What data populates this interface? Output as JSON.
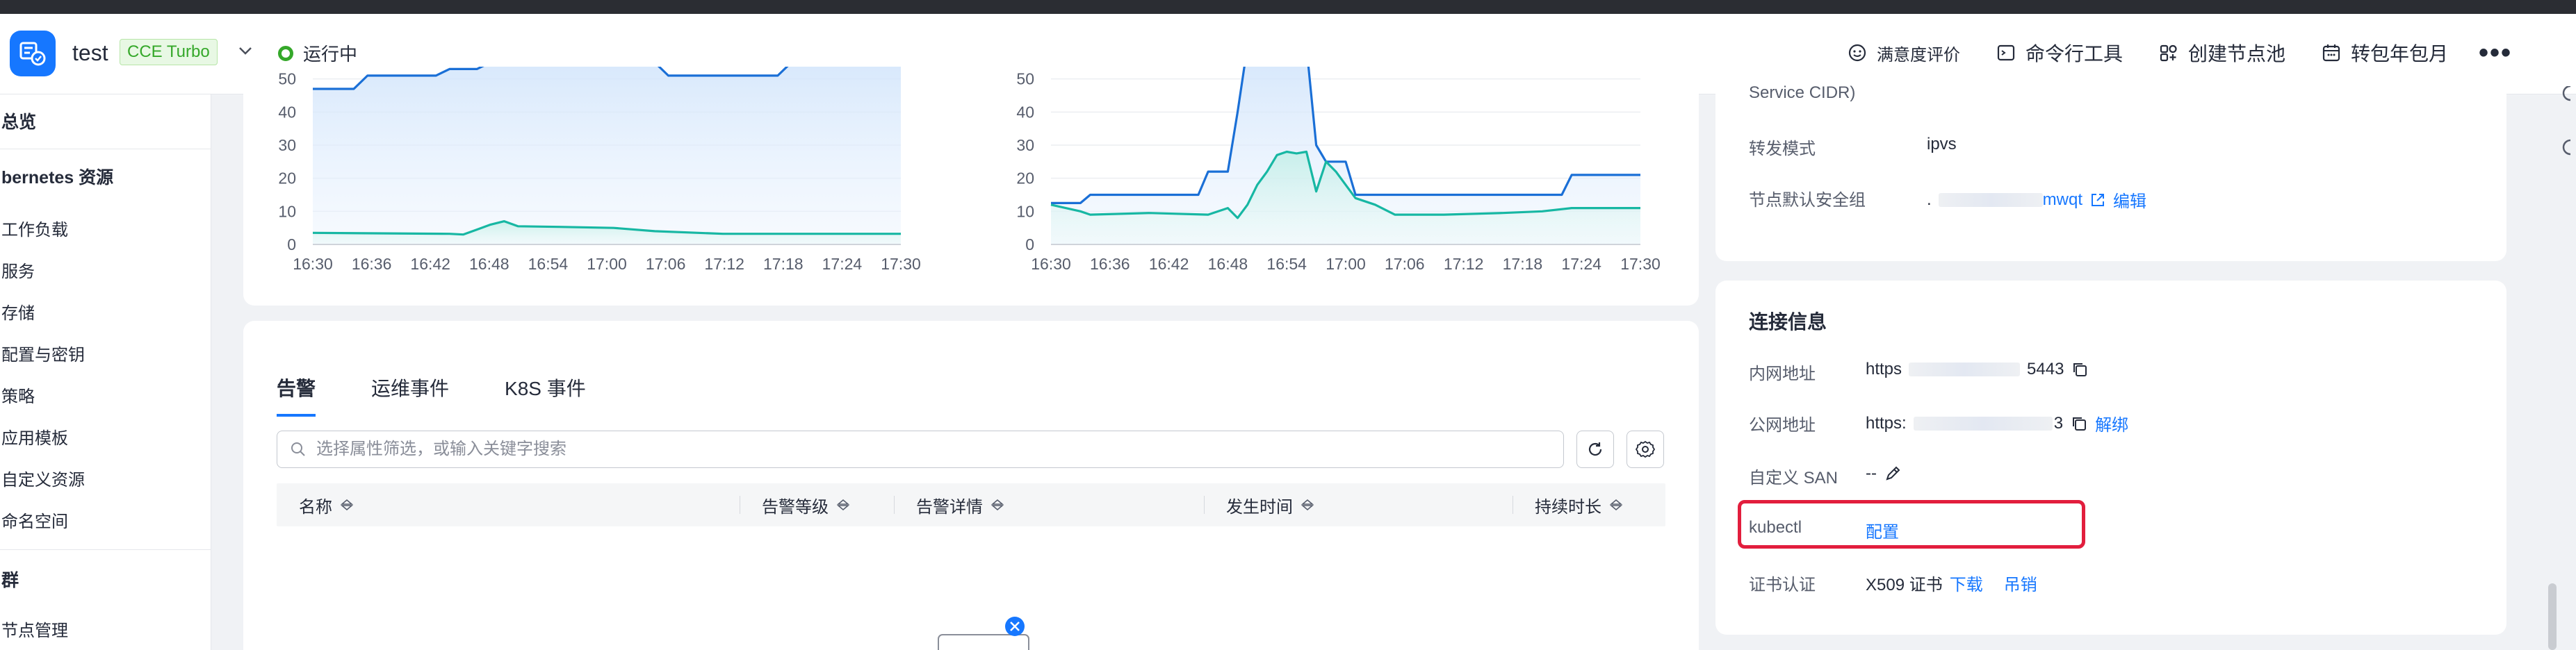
{
  "header": {
    "app_name": "test",
    "badge": "CCE Turbo",
    "status": "运行中",
    "actions": [
      {
        "label": "满意度评价",
        "icon": "smile-icon"
      },
      {
        "label": "命令行工具",
        "icon": "terminal-icon"
      },
      {
        "label": "创建节点池",
        "icon": "nodepool-icon"
      },
      {
        "label": "转包年包月",
        "icon": "calendar-icon"
      }
    ],
    "more": "•••"
  },
  "sidebar": {
    "items": [
      {
        "label": "总览",
        "bold": true
      },
      {
        "label": "bernetes 资源",
        "bold": true
      },
      {
        "label": "工作负载"
      },
      {
        "label": "服务"
      },
      {
        "label": "存储"
      },
      {
        "label": "配置与密钥"
      },
      {
        "label": "策略"
      },
      {
        "label": "应用模板"
      },
      {
        "label": "自定义资源"
      },
      {
        "label": "命名空间"
      },
      {
        "label": "群",
        "bold": true
      },
      {
        "label": "节点管理"
      }
    ]
  },
  "colors": {
    "accent": "#1677ff",
    "series_blue": "#1a6fd6",
    "series_teal": "#17b7a3",
    "status_green": "#35a82a",
    "highlight_red": "#e21e3d"
  },
  "chart_data": [
    {
      "type": "line",
      "title": "",
      "x": [
        "16:30",
        "16:36",
        "16:42",
        "16:48",
        "16:54",
        "17:00",
        "17:06",
        "17:12",
        "17:18",
        "17:24",
        "17:30"
      ],
      "ylim": [
        0,
        60
      ],
      "yticks": [
        0,
        10,
        20,
        30,
        40,
        50
      ],
      "series": [
        {
          "points": [
            [
              0,
              47
            ],
            [
              3,
              47
            ],
            [
              4,
              51
            ],
            [
              9,
              51
            ],
            [
              10,
              53
            ],
            [
              12,
              53
            ],
            [
              13,
              55
            ],
            [
              14,
              58
            ],
            [
              15,
              60
            ],
            [
              22,
              60
            ],
            [
              23,
              55
            ],
            [
              25,
              55
            ],
            [
              26,
              51
            ],
            [
              34,
              51
            ],
            [
              35,
              55
            ],
            [
              42,
              55
            ],
            [
              43,
              55
            ]
          ],
          "color": "#1a6fd6"
        },
        {
          "points": [
            [
              0,
              3.5
            ],
            [
              10,
              3.2
            ],
            [
              11,
              3
            ],
            [
              12,
              4.5
            ],
            [
              13,
              6
            ],
            [
              14,
              7
            ],
            [
              15,
              5.5
            ],
            [
              18,
              5.3
            ],
            [
              22,
              5
            ],
            [
              25,
              4
            ],
            [
              30,
              3.2
            ],
            [
              43,
              3.2
            ]
          ],
          "color": "#17b7a3"
        }
      ]
    },
    {
      "type": "line",
      "title": "",
      "x": [
        "16:30",
        "16:36",
        "16:42",
        "16:48",
        "16:54",
        "17:00",
        "17:06",
        "17:12",
        "17:18",
        "17:24",
        "17:30"
      ],
      "ylim": [
        0,
        60
      ],
      "yticks": [
        0,
        10,
        20,
        30,
        40,
        50
      ],
      "series": [
        {
          "points": [
            [
              0,
              12.5
            ],
            [
              3,
              12.5
            ],
            [
              4,
              15
            ],
            [
              15,
              15
            ],
            [
              16,
              22
            ],
            [
              18,
              22
            ],
            [
              19,
              40
            ],
            [
              20,
              60
            ],
            [
              26,
              60
            ],
            [
              27,
              30
            ],
            [
              28,
              25
            ],
            [
              30,
              25
            ],
            [
              31,
              15
            ],
            [
              41,
              15
            ],
            [
              42,
              15
            ],
            [
              52,
              15
            ],
            [
              53,
              21
            ],
            [
              60,
              21
            ]
          ],
          "color": "#1a6fd6"
        },
        {
          "points": [
            [
              0,
              12
            ],
            [
              3,
              10
            ],
            [
              4,
              9
            ],
            [
              10,
              9.5
            ],
            [
              16,
              9
            ],
            [
              18,
              11
            ],
            [
              19,
              8
            ],
            [
              20,
              12
            ],
            [
              21,
              18
            ],
            [
              22,
              22
            ],
            [
              23,
              27
            ],
            [
              24,
              28
            ],
            [
              25,
              27.5
            ],
            [
              26,
              28
            ],
            [
              27,
              16
            ],
            [
              28,
              25
            ],
            [
              29,
              22
            ],
            [
              31,
              14
            ],
            [
              33,
              12
            ],
            [
              35,
              9
            ],
            [
              40,
              9
            ],
            [
              46,
              9.5
            ],
            [
              50,
              10
            ],
            [
              53,
              11
            ],
            [
              60,
              11
            ]
          ],
          "color": "#17b7a3"
        }
      ]
    }
  ],
  "alerts": {
    "tabs": [
      "告警",
      "运维事件",
      "K8S 事件"
    ],
    "search_placeholder": "选择属性筛选，或输入关键字搜索",
    "columns": [
      "名称",
      "告警等级",
      "告警详情",
      "发生时间",
      "持续时长"
    ]
  },
  "network": {
    "partial_label": "Service CIDR)",
    "rows": [
      {
        "label": "转发模式",
        "value": "ipvs"
      },
      {
        "label": "节点默认安全组",
        "value": ".",
        "value_tail": "mwqt",
        "action": "编辑"
      }
    ]
  },
  "connection": {
    "title": "连接信息",
    "rows": [
      {
        "label": "内网地址",
        "value": "https",
        "value_tail": "5443"
      },
      {
        "label": "公网地址",
        "value": "https:",
        "value_tail": "3",
        "action": "解绑"
      },
      {
        "label": "自定义 SAN",
        "value": "--"
      },
      {
        "label": "kubectl",
        "action": "配置"
      },
      {
        "label": "证书认证",
        "value": "X509 证书",
        "action": "下载",
        "action2": "吊销"
      }
    ]
  }
}
